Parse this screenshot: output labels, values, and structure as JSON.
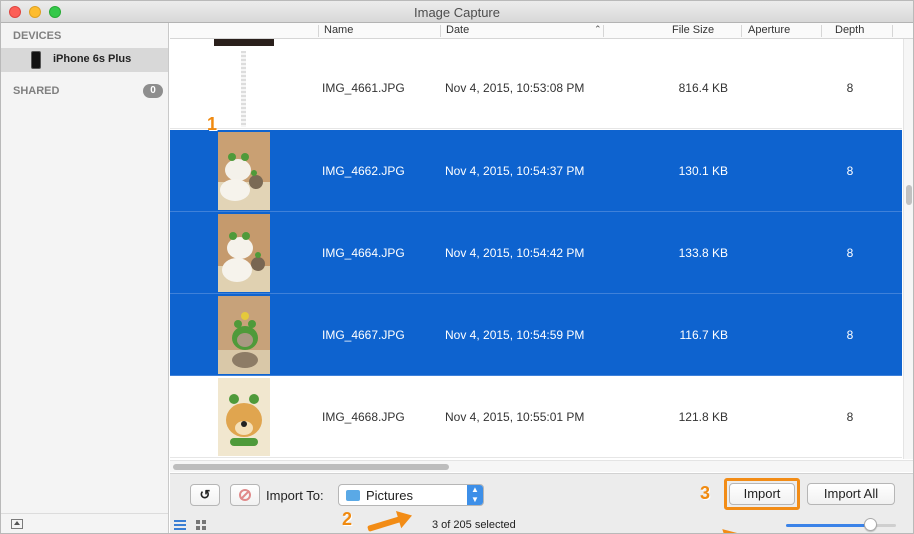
{
  "window": {
    "title": "Image Capture"
  },
  "sidebar": {
    "devices_heading": "DEVICES",
    "device_name": "iPhone 6s Plus",
    "shared_heading": "SHARED",
    "shared_count": "0"
  },
  "columns": {
    "name": "Name",
    "date": "Date",
    "size": "File Size",
    "aperture": "Aperture",
    "depth": "Depth"
  },
  "rows": [
    {
      "name": "IMG_4661.JPG",
      "date": "Nov 4, 2015, 10:53:08 PM",
      "size": "816.4 KB",
      "depth": "8",
      "selected": false
    },
    {
      "name": "IMG_4662.JPG",
      "date": "Nov 4, 2015, 10:54:37 PM",
      "size": "130.1 KB",
      "depth": "8",
      "selected": true
    },
    {
      "name": "IMG_4664.JPG",
      "date": "Nov 4, 2015, 10:54:42 PM",
      "size": "133.8 KB",
      "depth": "8",
      "selected": true
    },
    {
      "name": "IMG_4667.JPG",
      "date": "Nov 4, 2015, 10:54:59 PM",
      "size": "116.7 KB",
      "depth": "8",
      "selected": true
    },
    {
      "name": "IMG_4668.JPG",
      "date": "Nov 4, 2015, 10:55:01 PM",
      "size": "121.8 KB",
      "depth": "8",
      "selected": false
    }
  ],
  "toolbar": {
    "rotate_label": "↺",
    "import_to_label": "Import To:",
    "destination": "Pictures",
    "import_label": "Import",
    "import_all_label": "Import All",
    "status": "3 of 205 selected",
    "thumbnail_size_fraction": 0.75
  },
  "annotations": {
    "step1": "1",
    "step2": "2",
    "step3": "3"
  },
  "colors": {
    "accent": "#0e63cf",
    "annotation": "#f28c16"
  }
}
